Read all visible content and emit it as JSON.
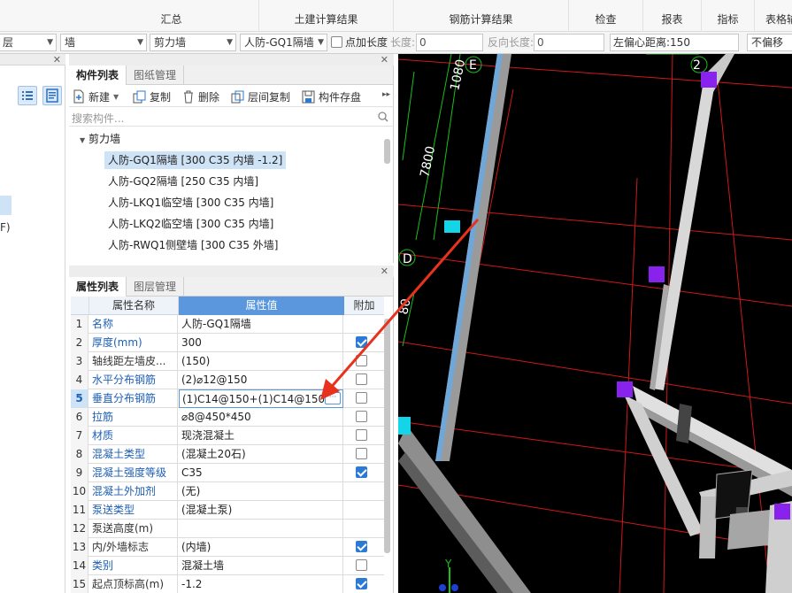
{
  "ribbon": {
    "items": [
      "汇总",
      "土建计算结果",
      "钢筋计算结果",
      "检查",
      "报表",
      "指标",
      "表格输"
    ]
  },
  "toolbar": {
    "floor": "层",
    "category": "墙",
    "type": "剪力墙",
    "component": "人防-GQ1隔墙",
    "point_length_label": "点加长度",
    "length_label": "长度:",
    "length_value": "0",
    "reverse_length_label": "反向长度:",
    "reverse_length_value": "0",
    "left_offset_label": "左偏心距离:",
    "left_offset_value": "150",
    "offset_mode": "不偏移"
  },
  "left_strip": {
    "tail_text": "F)"
  },
  "component_panel": {
    "tabs": [
      "构件列表",
      "图纸管理"
    ],
    "actions": [
      "新建",
      "复制",
      "删除",
      "层间复制",
      "构件存盘"
    ],
    "search_placeholder": "搜索构件...",
    "group": "剪力墙",
    "items": [
      "人防-GQ1隔墙 [300 C35 内墙 -1.2]",
      "人防-GQ2隔墙 [250 C35 内墙]",
      "人防-LKQ1临空墙 [300 C35 内墙]",
      "人防-LKQ2临空墙 [300 C35 内墙]",
      "人防-RWQ1侧壁墙 [300 C35 外墙]"
    ]
  },
  "property_panel": {
    "tabs": [
      "属性列表",
      "图层管理"
    ],
    "headers": [
      "属性名称",
      "属性值",
      "附加"
    ],
    "rows": [
      {
        "n": "1",
        "name": "名称",
        "value": "人防-GQ1隔墙",
        "blue": true,
        "check": null
      },
      {
        "n": "2",
        "name": "厚度(mm)",
        "value": "300",
        "blue": true,
        "check": true
      },
      {
        "n": "3",
        "name": "轴线距左墙皮...",
        "value": "(150)",
        "blue": false,
        "check": false
      },
      {
        "n": "4",
        "name": "水平分布钢筋",
        "value": "(2)⌀12@150",
        "blue": true,
        "check": false
      },
      {
        "n": "5",
        "name": "垂直分布钢筋",
        "value": "(1)C14@150+(1)C14@150",
        "blue": true,
        "check": false
      },
      {
        "n": "6",
        "name": "拉筋",
        "value": "⌀8@450*450",
        "blue": true,
        "check": false
      },
      {
        "n": "7",
        "name": "材质",
        "value": "现浇混凝土",
        "blue": true,
        "check": false
      },
      {
        "n": "8",
        "name": "混凝土类型",
        "value": "(混凝土20石)",
        "blue": true,
        "check": false
      },
      {
        "n": "9",
        "name": "混凝土强度等级",
        "value": "C35",
        "blue": true,
        "check": true
      },
      {
        "n": "10",
        "name": "混凝土外加剂",
        "value": "(无)",
        "blue": true,
        "check": null
      },
      {
        "n": "11",
        "name": "泵送类型",
        "value": "(混凝土泵)",
        "blue": true,
        "check": null
      },
      {
        "n": "12",
        "name": "泵送高度(m)",
        "value": "",
        "blue": false,
        "check": null
      },
      {
        "n": "13",
        "name": "内/外墙标志",
        "value": "(内墙)",
        "blue": false,
        "check": true
      },
      {
        "n": "14",
        "name": "类别",
        "value": "混凝土墙",
        "blue": true,
        "check": false
      },
      {
        "n": "15",
        "name": "起点顶标高(m)",
        "value": "-1.2",
        "blue": false,
        "check": true
      }
    ]
  },
  "viewport": {
    "dims": [
      "1080",
      "7800",
      "80"
    ],
    "axis_labels": [
      "E",
      "D",
      "2"
    ],
    "y_axis": "Y"
  },
  "colors": {
    "accent": "#2b7bd6",
    "selected_row": "#cfe3f7",
    "arrow": "#e8321e",
    "grid_red": "#d01818",
    "grid_green": "#18c018",
    "column_purple": "#8a22ee",
    "column_cyan": "#14d4e8"
  }
}
